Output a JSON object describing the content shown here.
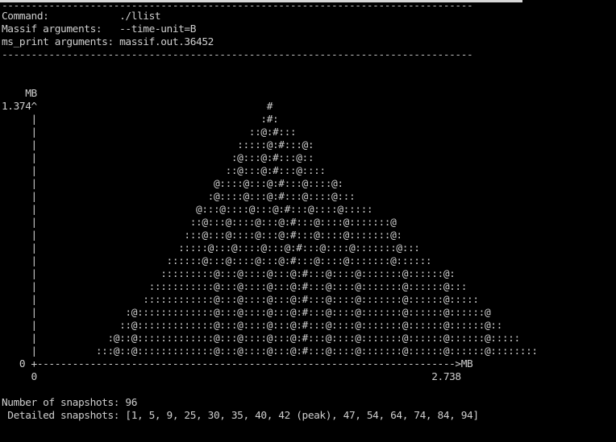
{
  "colors": {
    "background": "#000000",
    "text": "#cfcfcf"
  },
  "header": {
    "separator": "--------------------------------------------------------------------------------",
    "command": "Command:            ./llist",
    "massif_args": "Massif arguments:   --time-unit=B",
    "ms_print_args": "ms_print arguments: massif.out.36452"
  },
  "graph": {
    "unit_label": "    MB",
    "rows": [
      "1.374^                                       #",
      "     |                                      :#:",
      "     |                                    ::@:#:::",
      "     |                                  :::::@:#:::@:",
      "     |                                 :@:::@:#:::@::",
      "     |                                ::@:::@:#:::@::::",
      "     |                              @::::@:::@:#:::@::::@:",
      "     |                             :@::::@:::@:#:::@::::@:::",
      "     |                           @:::@::::@:::@:#:::@::::@:::::",
      "     |                          ::@:::@::::@:::@:#:::@::::@:::::::@",
      "     |                         :::@:::@::::@:::@:#:::@::::@:::::::@:",
      "     |                        :::::@:::@::::@:::@:#:::@::::@:::::::@:::",
      "     |                      ::::::@:::@::::@:::@:#:::@::::@:::::::@::::::",
      "     |                     :::::::::@:::@::::@:::@:#:::@::::@:::::::@::::::@:",
      "     |                   :::::::::::@:::@::::@:::@:#:::@::::@:::::::@::::::@:::",
      "     |                  ::::::::::::@:::@::::@:::@:#:::@::::@:::::::@::::::@:::::",
      "     |               :@:::::::::::::@:::@::::@:::@:#:::@::::@:::::::@::::::@::::::@",
      "     |              ::@:::::::::::::@:::@::::@:::@:#:::@::::@:::::::@::::::@::::::@::",
      "     |            :@::@:::::::::::::@:::@::::@:::@:#:::@::::@:::::::@::::::@::::::@:::::",
      "     |          :::@::@:::::::::::::@:::@::::@:::@:#:::@::::@:::::::@::::::@::::::@::::::::"
    ],
    "x_axis": "   0 +----------------------------------------------------------------------->MB",
    "x_ticks": "     0                                                                   2.738"
  },
  "footer": {
    "snapshots": "Number of snapshots: 96",
    "detailed": " Detailed snapshots: [1, 5, 9, 25, 30, 35, 40, 42 (peak), 47, 54, 64, 74, 84, 94]"
  }
}
